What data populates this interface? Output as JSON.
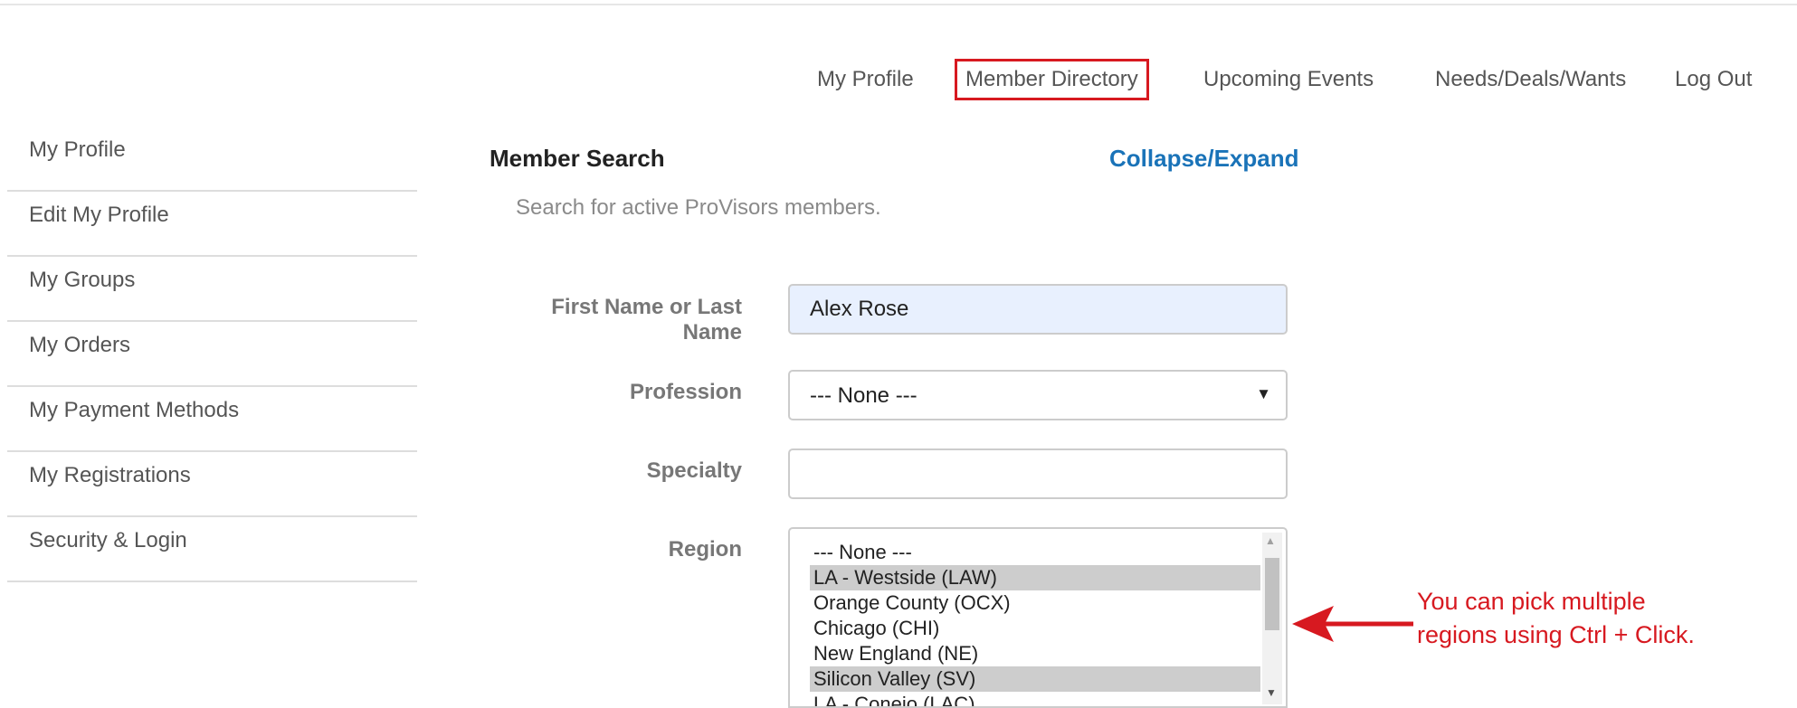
{
  "topnav": {
    "items": [
      {
        "label": "My Profile"
      },
      {
        "label": "Member Directory"
      },
      {
        "label": "Upcoming Events"
      },
      {
        "label": "Needs/Deals/Wants"
      },
      {
        "label": "Log Out"
      }
    ],
    "highlight_color": "#d71920"
  },
  "sidebar": {
    "items": [
      {
        "label": "My Profile"
      },
      {
        "label": "Edit My Profile"
      },
      {
        "label": "My Groups"
      },
      {
        "label": "My Orders"
      },
      {
        "label": "My Payment Methods"
      },
      {
        "label": "My Registrations"
      },
      {
        "label": "Security & Login"
      }
    ]
  },
  "search": {
    "title": "Member Search",
    "toggle_label": "Collapse/Expand",
    "subtitle": "Search for active ProVisors members.",
    "fields": {
      "name": {
        "label_line1": "First Name or Last",
        "label_line2": "Name",
        "value": "Alex Rose"
      },
      "profession": {
        "label": "Profession",
        "value": "--- None ---"
      },
      "specialty": {
        "label": "Specialty",
        "value": ""
      },
      "region": {
        "label": "Region",
        "options": [
          {
            "label": "--- None ---",
            "selected": false
          },
          {
            "label": "LA - Westside (LAW)",
            "selected": true
          },
          {
            "label": "Orange County (OCX)",
            "selected": false
          },
          {
            "label": "Chicago (CHI)",
            "selected": false
          },
          {
            "label": "New England (NE)",
            "selected": false
          },
          {
            "label": "Silicon Valley (SV)",
            "selected": true
          },
          {
            "label": "LA - Conejo (LAC)",
            "selected": false
          }
        ]
      }
    }
  },
  "annotation": {
    "line1": "You can pick multiple",
    "line2": "regions using Ctrl + Click.",
    "color": "#d71920"
  },
  "colors": {
    "link_blue": "#1a73b8",
    "input_fill": "#e8f0fe",
    "selected_option": "#cdcdcd"
  }
}
